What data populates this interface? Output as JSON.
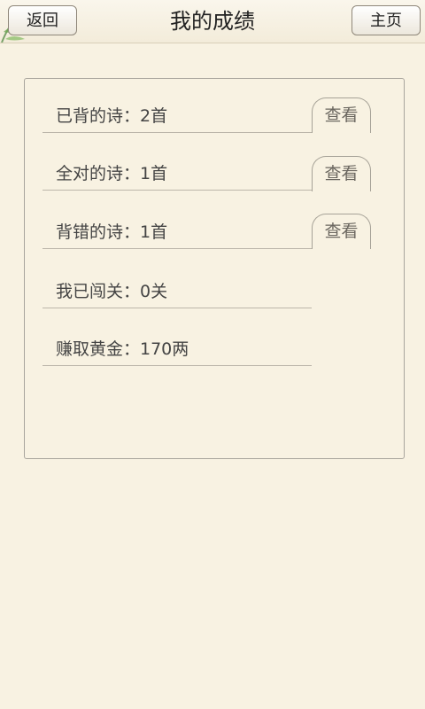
{
  "header": {
    "title": "我的成绩",
    "back_label": "返回",
    "home_label": "主页"
  },
  "stats": [
    {
      "label": "已背的诗：2首",
      "button": "查看"
    },
    {
      "label": "全对的诗：1首",
      "button": "查看"
    },
    {
      "label": "背错的诗：1首",
      "button": "查看"
    },
    {
      "label": "我已闯关：0关"
    },
    {
      "label": "赚取黄金：170两"
    }
  ]
}
